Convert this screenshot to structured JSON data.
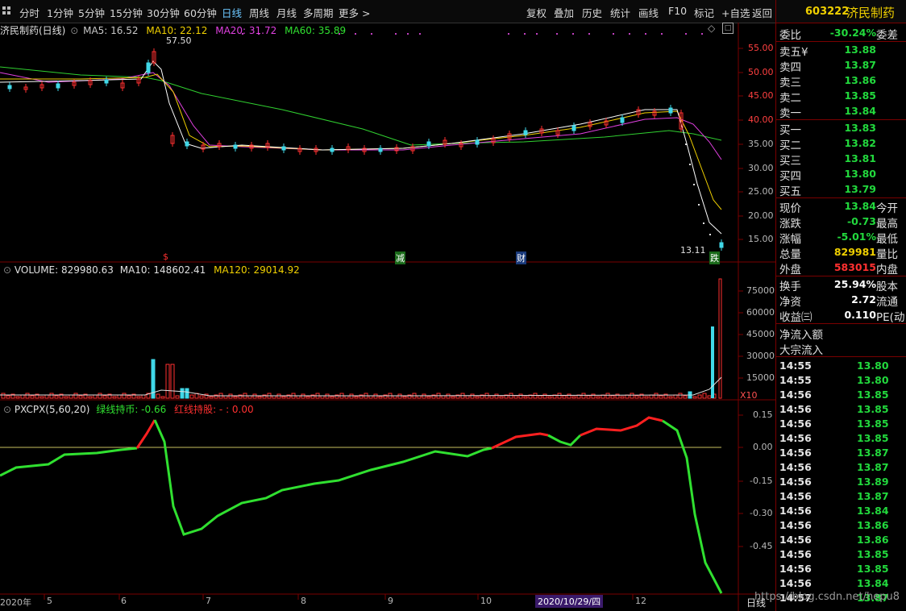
{
  "toolbar": {
    "periods": [
      "分时",
      "1分钟",
      "5分钟",
      "15分钟",
      "30分钟",
      "60分钟",
      "日线",
      "周线",
      "月线",
      "多周期",
      "更多 >"
    ],
    "active_period": "日线",
    "tools": [
      "复权",
      "叠加",
      "历史",
      "统计",
      "画线",
      "F10",
      "标记",
      "+自选",
      "返回"
    ]
  },
  "stock": {
    "code": "603222",
    "name": "济民制药"
  },
  "main_chart": {
    "title": "济民制药(日线)",
    "ma_labels": [
      {
        "text": "MA5: 16.52",
        "color": "#e0e0e0"
      },
      {
        "text": "MA10: 22.12",
        "color": "#f0d000"
      },
      {
        "text": "MA20: 31.72",
        "color": "#e040e0"
      },
      {
        "text": "MA60: 35.89",
        "color": "#30e030"
      }
    ],
    "y_ticks": [
      "55.00",
      "50.00",
      "45.00",
      "40.00",
      "35.00",
      "30.00",
      "25.00",
      "20.00",
      "15.00"
    ],
    "high_label": "57.50",
    "low_label": "13.11",
    "markers": [
      {
        "text": "$",
        "color": "#ff3030",
        "bg": "none"
      },
      {
        "text": "减",
        "color": "#fff",
        "bg": "#1a6a1a"
      },
      {
        "text": "财",
        "color": "#fff",
        "bg": "#1a3a7a"
      },
      {
        "text": "跌",
        "color": "#fff",
        "bg": "#1a6a1a"
      }
    ]
  },
  "volume_chart": {
    "labels": [
      {
        "text": "VOLUME: 829980.63",
        "color": "#e0e0e0"
      },
      {
        "text": "MA10: 148602.41",
        "color": "#e0e0e0"
      },
      {
        "text": "MA120: 29014.92",
        "color": "#f0d000"
      }
    ],
    "y_ticks": [
      "75000",
      "60000",
      "45000",
      "30000",
      "15000"
    ],
    "unit": "X10"
  },
  "indicator_chart": {
    "labels": [
      {
        "text": "PXCPX(5,60,20)",
        "color": "#e0e0e0"
      },
      {
        "text": "绿线持币: -0.66",
        "color": "#30e030"
      },
      {
        "text": "红线持股: - : 0.00",
        "color": "#ff3030"
      }
    ],
    "y_ticks": [
      "0.15",
      "0.00",
      "-0.15",
      "-0.30",
      "-0.45"
    ]
  },
  "x_axis": {
    "labels": [
      "2020年",
      "5",
      "6",
      "7",
      "8",
      "9",
      "10",
      "12"
    ],
    "selected_date": "2020/10/29/四",
    "period_tag": "日线"
  },
  "quote_panel": {
    "weibi": {
      "label": "委比",
      "value": "-30.24%",
      "label2": "委差"
    },
    "sell": [
      {
        "label": "卖五",
        "price": "13.88",
        "mark": "¥"
      },
      {
        "label": "卖四",
        "price": "13.87"
      },
      {
        "label": "卖三",
        "price": "13.86"
      },
      {
        "label": "卖二",
        "price": "13.85"
      },
      {
        "label": "卖一",
        "price": "13.84"
      }
    ],
    "buy": [
      {
        "label": "买一",
        "price": "13.83"
      },
      {
        "label": "买二",
        "price": "13.82"
      },
      {
        "label": "买三",
        "price": "13.81"
      },
      {
        "label": "买四",
        "price": "13.80"
      },
      {
        "label": "买五",
        "price": "13.79"
      }
    ],
    "stats": [
      {
        "label": "现价",
        "value": "13.84",
        "label2": "今开",
        "color": "green"
      },
      {
        "label": "涨跌",
        "value": "-0.73",
        "label2": "最高",
        "color": "green"
      },
      {
        "label": "涨幅",
        "value": "-5.01%",
        "label2": "最低",
        "color": "green"
      },
      {
        "label": "总量",
        "value": "829981",
        "label2": "量比",
        "color": "yellow"
      },
      {
        "label": "外盘",
        "value": "583015",
        "label2": "内盘",
        "color": "red"
      }
    ],
    "stats2": [
      {
        "label": "换手",
        "value": "25.94%",
        "label2": "股本"
      },
      {
        "label": "净资",
        "value": "2.72",
        "label2": "流通"
      },
      {
        "label": "收益㈢",
        "value": "0.110",
        "label2": "PE(动"
      }
    ],
    "flow": [
      {
        "label": "净流入额"
      },
      {
        "label": "大宗流入"
      }
    ],
    "ticks": [
      {
        "time": "14:55",
        "price": "13.80"
      },
      {
        "time": "14:55",
        "price": "13.80"
      },
      {
        "time": "14:56",
        "price": "13.85"
      },
      {
        "time": "14:56",
        "price": "13.85"
      },
      {
        "time": "14:56",
        "price": "13.85"
      },
      {
        "time": "14:56",
        "price": "13.85"
      },
      {
        "time": "14:56",
        "price": "13.87"
      },
      {
        "time": "14:56",
        "price": "13.87"
      },
      {
        "time": "14:56",
        "price": "13.89"
      },
      {
        "time": "14:56",
        "price": "13.87"
      },
      {
        "time": "14:56",
        "price": "13.84"
      },
      {
        "time": "14:56",
        "price": "13.86"
      },
      {
        "time": "14:56",
        "price": "13.86"
      },
      {
        "time": "14:56",
        "price": "13.85"
      },
      {
        "time": "14:56",
        "price": "13.85"
      },
      {
        "time": "14:56",
        "price": "13.84"
      },
      {
        "time": "14:57",
        "price": "13.87"
      }
    ]
  },
  "watermark": "https://blog.csdn.net/hepu8"
}
